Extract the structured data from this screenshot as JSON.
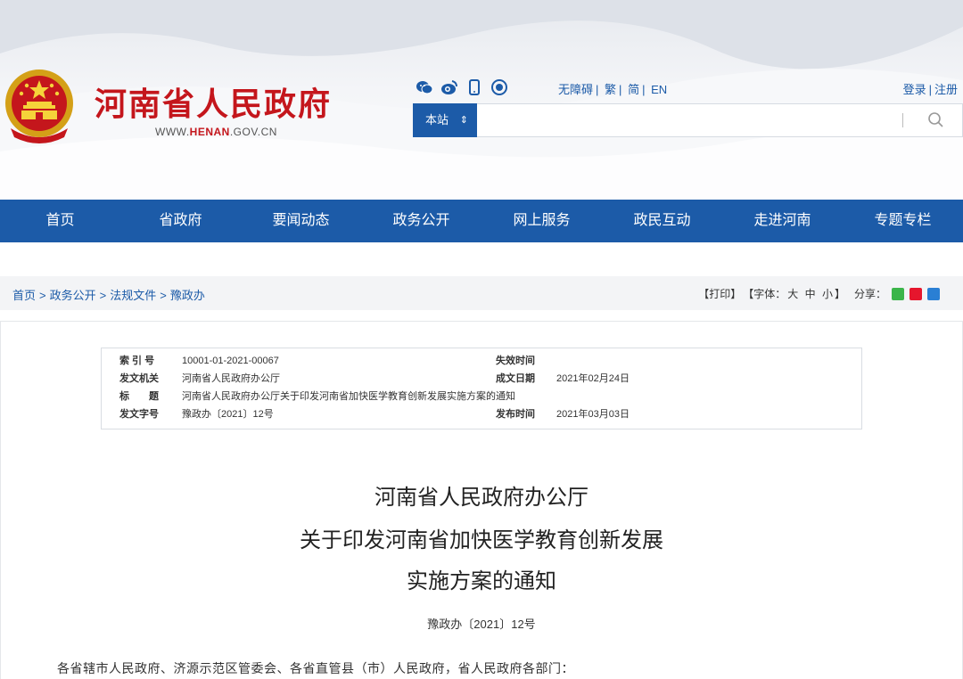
{
  "header": {
    "site_title": "河南省人民政府",
    "site_url_prefix": "WWW.",
    "site_url_highlight": "HENAN",
    "site_url_suffix": ".GOV.CN",
    "social_icons": [
      "wechat-icon",
      "weibo-icon",
      "mobile-icon",
      "podcast-icon"
    ],
    "links": [
      "无障碍",
      "繁",
      "简",
      "EN"
    ],
    "login": "登录",
    "register": "注册",
    "search_scope": "本站",
    "search_placeholder": ""
  },
  "nav": {
    "items": [
      "首页",
      "省政府",
      "要闻动态",
      "政务公开",
      "网上服务",
      "政民互动",
      "走进河南",
      "专题专栏"
    ]
  },
  "breadcrumb": {
    "items": [
      "首页",
      "政务公开",
      "法规文件",
      "豫政办"
    ],
    "print": "【打印】",
    "font_label": "【字体：",
    "font_big": "大",
    "font_mid": "中",
    "font_small": "小",
    "font_close": "】",
    "share": "分享："
  },
  "meta": {
    "index_label": "索 引 号",
    "index_value": "10001-01-2021-00067",
    "expire_label": "失效时间",
    "expire_value": "",
    "issuer_label": "发文机关",
    "issuer_value": "河南省人民政府办公厅",
    "created_label": "成文日期",
    "created_value": "2021年02月24日",
    "title_label": "标　　题",
    "title_value": "河南省人民政府办公厅关于印发河南省加快医学教育创新发展实施方案的通知",
    "docno_label": "发文字号",
    "docno_value": "豫政办〔2021〕12号",
    "published_label": "发布时间",
    "published_value": "2021年03月03日"
  },
  "document": {
    "title_line1": "河南省人民政府办公厅",
    "title_line2": "关于印发河南省加快医学教育创新发展",
    "title_line3": "实施方案的通知",
    "doc_number": "豫政办〔2021〕12号",
    "salutation": "各省辖市人民政府、济源示范区管委会、各省直管县（市）人民政府，省人民政府各部门："
  },
  "colors": {
    "brand_red": "#c4161c",
    "brand_blue": "#1c5ba8"
  }
}
